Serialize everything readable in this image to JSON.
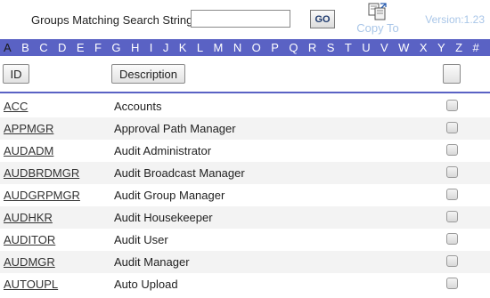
{
  "toolbar": {
    "search_label": "Groups Matching Search String",
    "search_value": "",
    "go_label": "GO",
    "copy_label": "Copy To",
    "version": "Version:1.23"
  },
  "alphabet": [
    "A",
    "B",
    "C",
    "D",
    "E",
    "F",
    "G",
    "H",
    "I",
    "J",
    "K",
    "L",
    "M",
    "N",
    "O",
    "P",
    "Q",
    "R",
    "S",
    "T",
    "U",
    "V",
    "W",
    "X",
    "Y",
    "Z",
    "#"
  ],
  "alphabet_active": "A",
  "columns": {
    "id_label": "ID",
    "description_label": "Description"
  },
  "colors": {
    "accent": "#5a62c4",
    "muted_text": "#a9c6e8",
    "alt_row": "#f3f3f3"
  },
  "icons": {
    "copy": "copy-icon"
  },
  "groups": [
    {
      "id": "ACC",
      "description": "Accounts"
    },
    {
      "id": "APPMGR",
      "description": "Approval Path Manager"
    },
    {
      "id": "AUDADM",
      "description": "Audit Administrator"
    },
    {
      "id": "AUDBRDMGR",
      "description": "Audit Broadcast Manager"
    },
    {
      "id": "AUDGRPMGR",
      "description": "Audit Group Manager"
    },
    {
      "id": "AUDHKR",
      "description": "Audit Housekeeper"
    },
    {
      "id": "AUDITOR",
      "description": "Audit User"
    },
    {
      "id": "AUDMGR",
      "description": "Audit Manager"
    },
    {
      "id": "AUTOUPL",
      "description": "Auto Upload"
    }
  ]
}
